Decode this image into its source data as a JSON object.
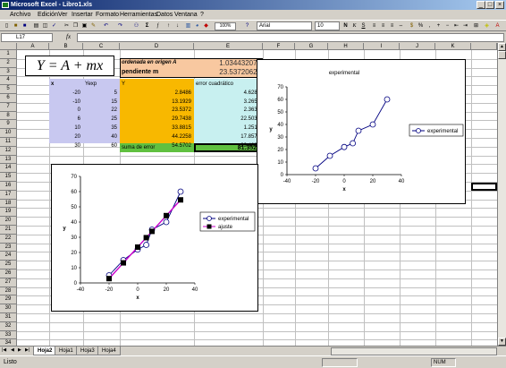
{
  "window": {
    "title": "Microsoft Excel - Libro1.xls"
  },
  "menu": [
    "Archivo",
    "Edición",
    "Ver",
    "Insertar",
    "Formato",
    "Herramientas",
    "Datos",
    "Ventana",
    "?"
  ],
  "toolbar": {
    "font": "Arial",
    "size": "10",
    "zoom": "100%"
  },
  "formula": {
    "cell": "L17",
    "fx": "fx",
    "content": ""
  },
  "columns": [
    "A",
    "B",
    "C",
    "D",
    "E",
    "F",
    "G",
    "H",
    "I",
    "J",
    "K"
  ],
  "rows": [
    "1",
    "2",
    "3",
    "4",
    "5",
    "6",
    "7",
    "8",
    "9",
    "10",
    "11",
    "12",
    "13",
    "14",
    "15",
    "16",
    "17",
    "18",
    "19",
    "20",
    "21",
    "22",
    "23",
    "24",
    "25",
    "26",
    "27",
    "28",
    "29",
    "30",
    "31",
    "32",
    "33",
    "34",
    "35",
    "36",
    "37"
  ],
  "sheet": {
    "equation": "Y = A + mx",
    "intercept_label": "ordenada en origen A",
    "intercept_value": "1.034432074",
    "slope_label": "pendiente m",
    "slope_value": "23.53720626",
    "headers": [
      "x",
      "Yexp",
      "Y",
      "error cuadrático"
    ],
    "table": [
      [
        "-20",
        "5",
        "2.8486",
        "4.6287"
      ],
      [
        "-10",
        "15",
        "13.1929",
        "3.2657"
      ],
      [
        "0",
        "22",
        "23.5372",
        "2.3630"
      ],
      [
        "6",
        "25",
        "29.7438",
        "22.5036"
      ],
      [
        "10",
        "35",
        "33.8815",
        "1.2510"
      ],
      [
        "20",
        "40",
        "44.2258",
        "17.8578"
      ],
      [
        "30",
        "60",
        "54.5702",
        "29.4831"
      ]
    ],
    "sum_label": "suma de error",
    "sum_value": "81.3528"
  },
  "chart_data": [
    {
      "type": "line",
      "title": "experimental",
      "xlabel": "x",
      "ylabel": "y",
      "xlim": [
        -40,
        40
      ],
      "ylim": [
        0,
        70
      ],
      "xticks": [
        "-40",
        "-20",
        "0",
        "20",
        "40"
      ],
      "yticks": [
        "0",
        "10",
        "20",
        "30",
        "40",
        "50",
        "60",
        "70"
      ],
      "legend_position": "right",
      "series": [
        {
          "name": "experimental",
          "x": [
            -20,
            -10,
            0,
            6,
            10,
            20,
            30
          ],
          "y": [
            5,
            15,
            22,
            25,
            35,
            40,
            60
          ],
          "color": "#000080",
          "marker": "circle"
        }
      ]
    },
    {
      "type": "line",
      "title": "",
      "xlabel": "x",
      "ylabel": "y",
      "xlim": [
        -40,
        40
      ],
      "ylim": [
        0,
        70
      ],
      "xticks": [
        "-40",
        "-20",
        "0",
        "20",
        "40"
      ],
      "yticks": [
        "0",
        "10",
        "20",
        "30",
        "40",
        "50",
        "60",
        "70"
      ],
      "legend_position": "right",
      "series": [
        {
          "name": "experimental",
          "x": [
            -20,
            -10,
            0,
            6,
            10,
            20,
            30
          ],
          "y": [
            5,
            15,
            22,
            25,
            35,
            40,
            60
          ],
          "color": "#000080",
          "marker": "circle"
        },
        {
          "name": "ajuste",
          "x": [
            -20,
            -10,
            0,
            6,
            10,
            20,
            30
          ],
          "y": [
            2.8486,
            13.1929,
            23.5372,
            29.7438,
            33.8815,
            44.2258,
            54.5702
          ],
          "color": "#cc00cc",
          "marker": "square"
        }
      ]
    }
  ],
  "sheets": [
    "Hoja2",
    "Hoja1",
    "Hoja3",
    "Hoja4"
  ],
  "status": {
    "left": "Listo",
    "num": "NUM"
  }
}
